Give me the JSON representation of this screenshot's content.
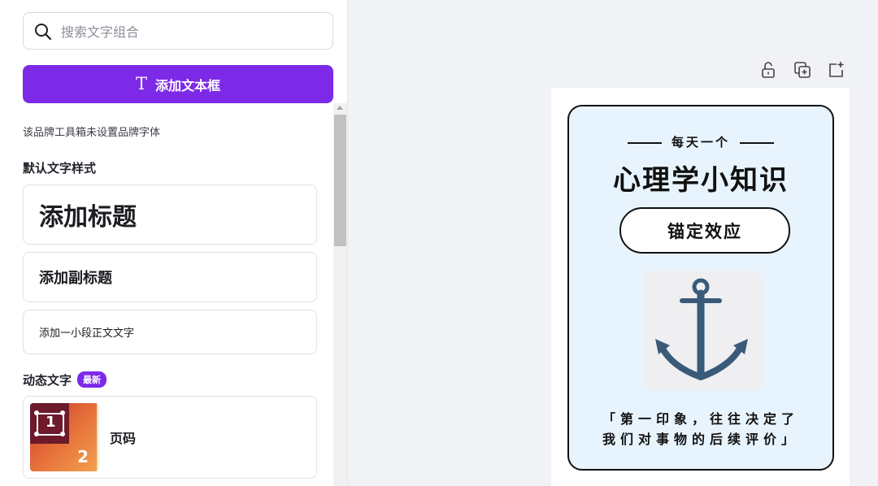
{
  "search": {
    "placeholder": "搜索文字组合"
  },
  "add_textbox": {
    "label": "添加文本框"
  },
  "brand_notice": "该品牌工具箱未设置品牌字体",
  "default_styles": {
    "title": "默认文字样式",
    "heading": "添加标题",
    "subheading": "添加副标题",
    "body": "添加一小段正文文字"
  },
  "dynamic_text": {
    "title": "动态文字",
    "badge": "最新",
    "page_numbers": {
      "label": "页码",
      "thumb_front": "1",
      "thumb_back": "2"
    }
  },
  "toolbar": {
    "icons": [
      "lock-icon",
      "duplicate-icon",
      "add-page-icon"
    ]
  },
  "design": {
    "eyebrow": "每天一个",
    "headline": "心理学小知识",
    "pill": "锚定效应",
    "quote_line1": "「第一印象，往往决定了",
    "quote_line2": "我们对事物的后续评价」",
    "colors": {
      "card_bg": "#e8f4fd",
      "anchor": "#3a5a7a",
      "accent": "#7d2ae8"
    }
  }
}
